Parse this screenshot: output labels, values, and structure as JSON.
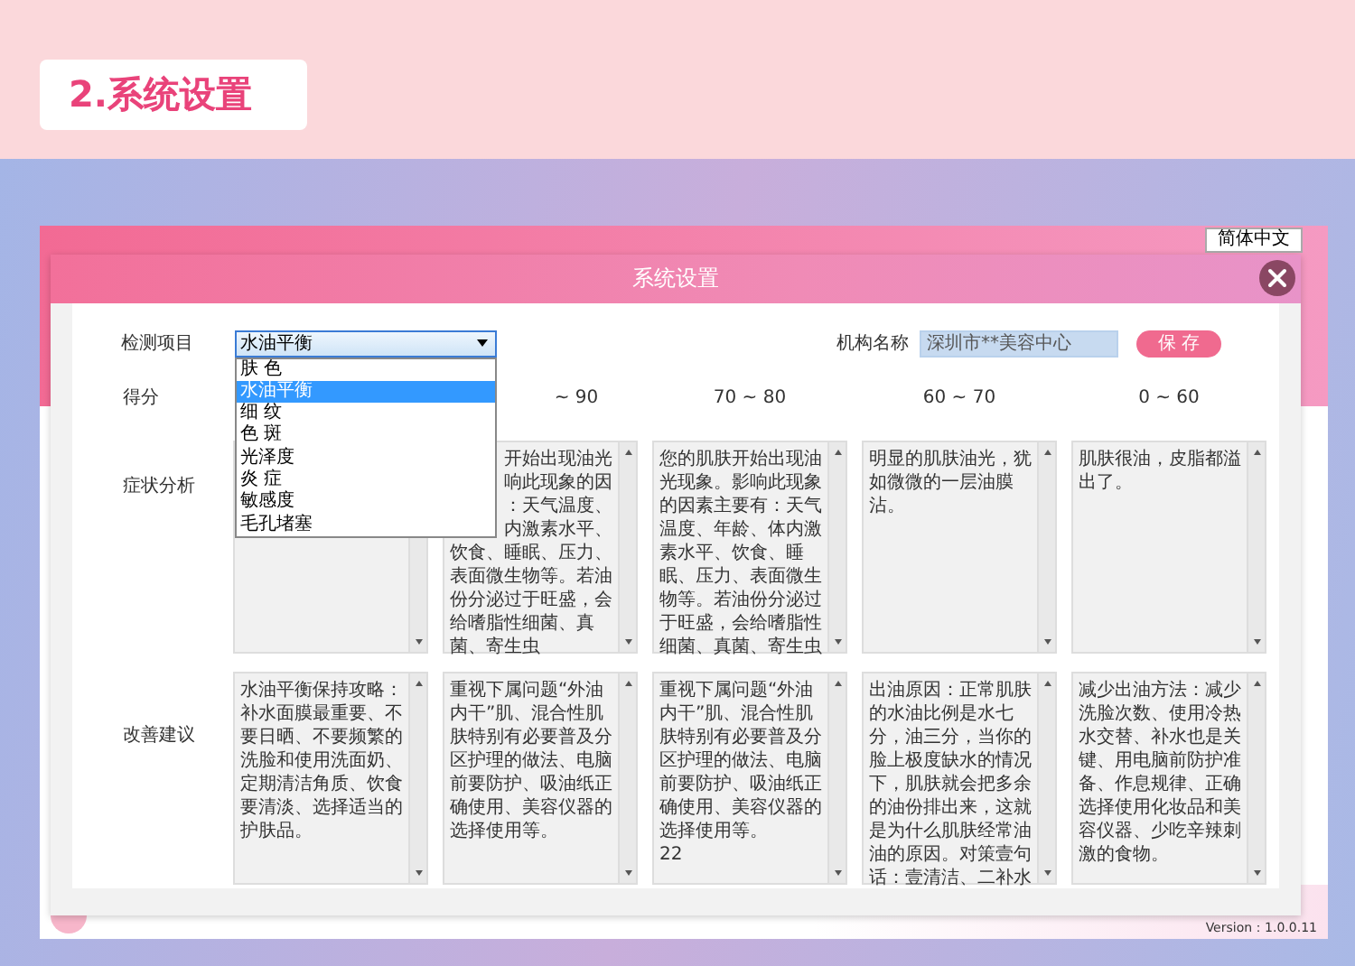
{
  "banner": {
    "title": "2.系统设置"
  },
  "app": {
    "language": "简体中文",
    "version": "Version：1.0.0.11"
  },
  "dialog": {
    "title": "系统设置",
    "test_item": {
      "label": "检测项目",
      "value": "水油平衡",
      "expanded": true,
      "options": [
        {
          "label": "肤 色",
          "selected": false
        },
        {
          "label": "水油平衡",
          "selected": true
        },
        {
          "label": "细 纹",
          "selected": false
        },
        {
          "label": "色 斑",
          "selected": false
        },
        {
          "label": "光泽度",
          "selected": false
        },
        {
          "label": "炎 症",
          "selected": false
        },
        {
          "label": "敏感度",
          "selected": false
        },
        {
          "label": "毛孔堵塞",
          "selected": false
        }
      ]
    },
    "org": {
      "label": "机构名称",
      "value": "深圳市**美容中心"
    },
    "save_button": "保 存",
    "score_label": "得分",
    "symptom_label": "症状分析",
    "advice_label": "改善建议",
    "columns": [
      {
        "advice": "水油平衡保持攻略：补水面膜最重要、不要日晒、不要频繁的洗脸和使用洗面奶、定期清洁角质、饮食要清淡、选择适当的护肤品。"
      },
      {
        "score": "~ 90",
        "symptom_fragments": [
          "开始出现油光",
          "响此现象的因",
          "：天气温度、",
          "内激素水平、"
        ],
        "symptom": "饮食、睡眠、压力、表面微生物等。若油份分泌过于旺盛，会给嗜脂性细菌、真菌、寄生虫",
        "advice": "重视下属问题“外油内干”肌、混合性肌肤特别有必要普及分区护理的做法、电脑前要防护、吸油纸正确使用、美容仪器的选择使用等。"
      },
      {
        "score": "70 ~ 80",
        "symptom": "您的肌肤开始出现油光现象。影响此现象的因素主要有：天气温度、年龄、体内激素水平、饮食、睡眠、压力、表面微生物等。若油份分泌过于旺盛，会给嗜脂性细菌、真菌、寄生虫",
        "advice": "重视下属问题“外油内干”肌、混合性肌肤特别有必要普及分区护理的做法、电脑前要防护、吸油纸正确使用、美容仪器的选择使用等。\n22"
      },
      {
        "score": "60 ~ 70",
        "symptom": "明显的肌肤油光，犹如微微的一层油膜沾。",
        "advice": "出油原因：正常肌肤的水油比例是水七分，油三分，当你的脸上极度缺水的情况下，肌肤就会把多余的油份排出来，这就是为什么肌肤经常油油的原因。对策壹句话：壹清洁、二补水"
      },
      {
        "score": "0 ~ 60",
        "symptom": "肌肤很油，皮脂都溢出了。",
        "advice": "减少出油方法：减少洗脸次数、使用冷热水交替、补水也是关键、用电脑前防护准备、作息规律、正确选择使用化妆品和美容仪器、少吃辛辣刺激的食物。"
      }
    ]
  }
}
